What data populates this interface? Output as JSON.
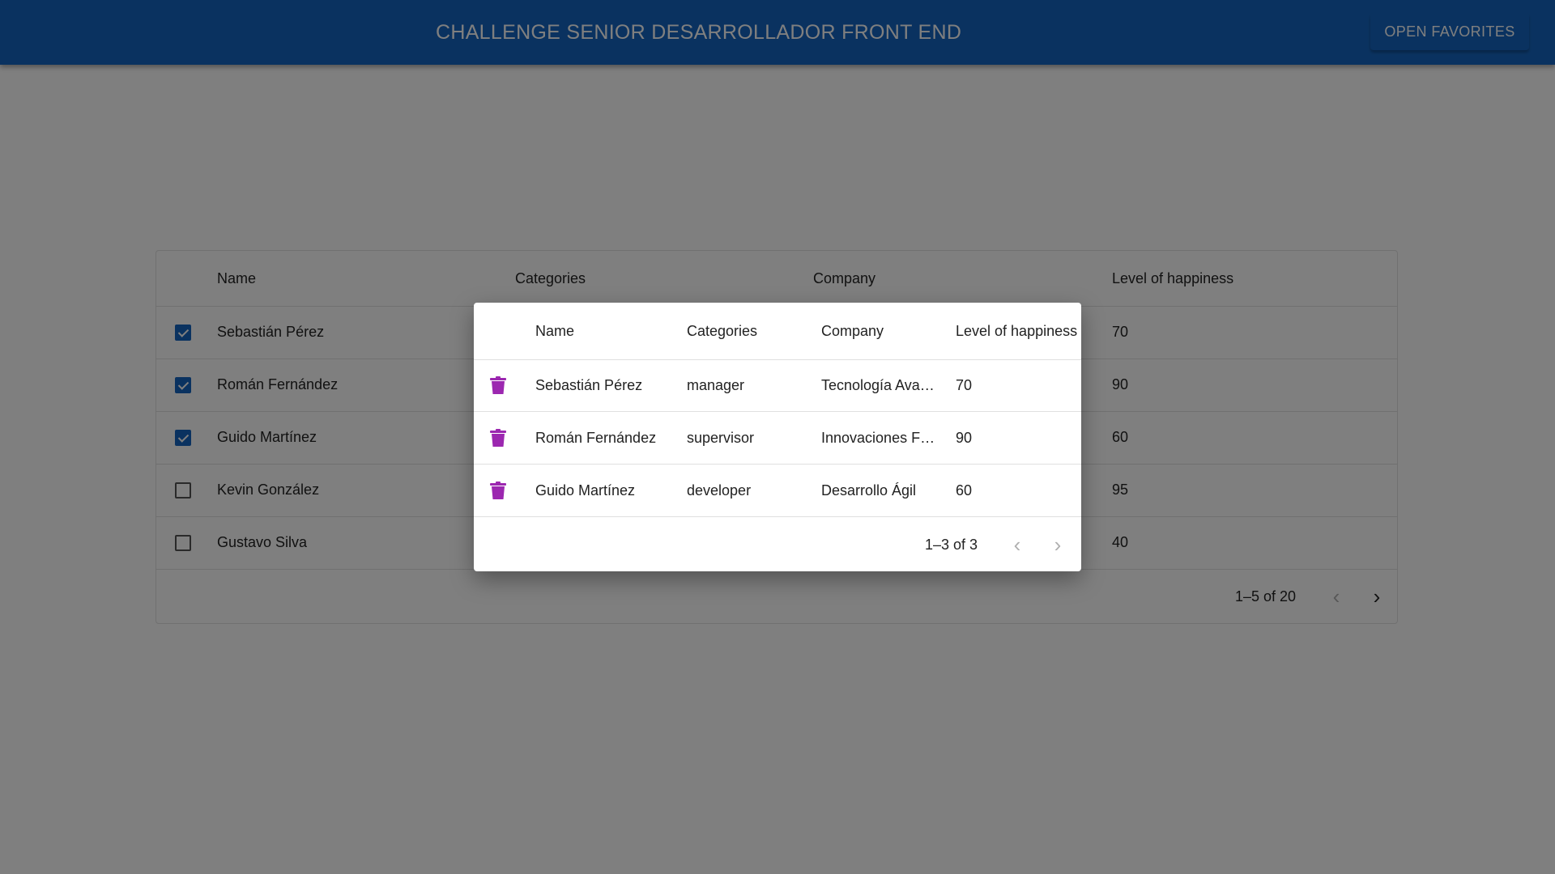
{
  "appbar": {
    "title": "CHALLENGE SENIOR DESARROLLADOR FRONT END",
    "favorites_button": "OPEN FAVORITES"
  },
  "colors": {
    "primary": "#1565c0",
    "delete_icon": "#9c27b0"
  },
  "grid": {
    "columns": [
      "Name",
      "Categories",
      "Company",
      "Level of happiness"
    ],
    "rows": [
      {
        "checked": true,
        "name": "Sebastián Pérez",
        "happiness": "70"
      },
      {
        "checked": true,
        "name": "Román Fernández",
        "happiness": "90"
      },
      {
        "checked": true,
        "name": "Guido Martínez",
        "happiness": "60"
      },
      {
        "checked": false,
        "name": "Kevin González",
        "happiness": "95"
      },
      {
        "checked": false,
        "name": "Gustavo Silva",
        "happiness": "40"
      }
    ],
    "pagination": {
      "label": "1–5 of 20",
      "prev_icon": "chevron-left-icon",
      "next_icon": "chevron-right-icon"
    }
  },
  "favorites_modal": {
    "columns": [
      "Name",
      "Categories",
      "Company",
      "Level of happiness"
    ],
    "rows": [
      {
        "icon": "trash-icon",
        "name": "Sebastián Pérez",
        "category": "manager",
        "company": "Tecnología Ava…",
        "happiness": "70"
      },
      {
        "icon": "trash-icon",
        "name": "Román Fernández",
        "category": "supervisor",
        "company": "Innovaciones F…",
        "happiness": "90"
      },
      {
        "icon": "trash-icon",
        "name": "Guido Martínez",
        "category": "developer",
        "company": "Desarrollo Ágil",
        "happiness": "60"
      }
    ],
    "pagination": {
      "label": "1–3 of 3",
      "prev_icon": "chevron-left-icon",
      "next_icon": "chevron-right-icon"
    }
  }
}
